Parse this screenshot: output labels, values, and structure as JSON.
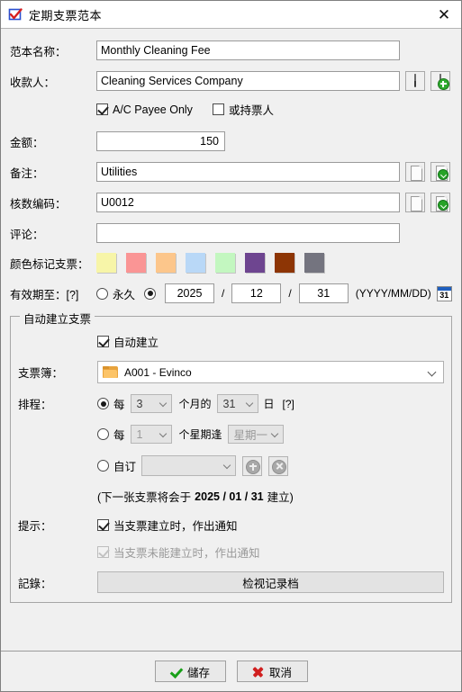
{
  "window": {
    "title": "定期支票范本",
    "title_icon": "cheque-check-icon",
    "close_label": "✕"
  },
  "form": {
    "template_name": {
      "label": "范本名称：",
      "value": "Monthly Cleaning Fee"
    },
    "payee": {
      "label": "收款人：",
      "value": "Cleaning Services Company",
      "buttons": [
        {
          "icon": "person-icon"
        },
        {
          "icon": "person-add-icon"
        }
      ]
    },
    "cheque_options": {
      "ac_payee_only": {
        "label": "A/C Payee Only",
        "checked": true
      },
      "or_bearer": {
        "label": "或持票人",
        "checked": false
      }
    },
    "amount": {
      "label": "金额：",
      "value": "150"
    },
    "remark": {
      "label": "备注：",
      "value": "Utilities",
      "buttons": [
        {
          "icon": "page-icon"
        },
        {
          "icon": "page-save-icon"
        }
      ]
    },
    "audit_code": {
      "label": "核数编码：",
      "value": "U0012",
      "buttons": [
        {
          "icon": "page-icon"
        },
        {
          "icon": "page-save-icon"
        }
      ]
    },
    "comment": {
      "label": "评论：",
      "value": ""
    },
    "color_tag": {
      "label": "颜色标记支票：",
      "colors": [
        "#f7f5a8",
        "#fa9595",
        "#fcc68b",
        "#b9d8f7",
        "#c3f7c0",
        "#6e4590",
        "#8d3505",
        "#74747f"
      ]
    },
    "validity": {
      "label": "有效期至：[?]",
      "forever": {
        "label": "永久",
        "selected": false
      },
      "until": {
        "selected": true
      },
      "year": "2025",
      "month": "12",
      "day": "31",
      "format_hint": "(YYYY/MM/DD)",
      "calendar_icon_day": "31"
    }
  },
  "auto_create": {
    "legend": "自动建立支票",
    "auto_create_checkbox": {
      "label": "自动建立",
      "checked": true
    },
    "chequebook": {
      "label": "支票簿：",
      "value": "A001 - Evinco",
      "icon": "folder-icon"
    },
    "schedule": {
      "label": "排程：",
      "monthly": {
        "selected": true,
        "prefix": "每",
        "interval": "3",
        "middle": "个月的",
        "day": "31",
        "suffix": "日",
        "hint": "[?]"
      },
      "weekly": {
        "selected": false,
        "prefix": "每",
        "interval": "1",
        "middle": "个星期逢",
        "weekday": "星期一"
      },
      "custom": {
        "selected": false,
        "label": "自订",
        "value": "",
        "add_icon": "circle-plus-icon",
        "remove_icon": "circle-cross-icon"
      },
      "next_note_prefix": "(下一张支票将会于",
      "next_note_date": "2025 / 01 / 31",
      "next_note_suffix": "建立)"
    },
    "notify": {
      "label": "提示：",
      "on_created": {
        "label": "当支票建立时，作出通知",
        "checked": true,
        "enabled": true
      },
      "on_failed": {
        "label": "当支票未能建立时，作出通知",
        "checked": true,
        "enabled": false
      }
    },
    "record": {
      "label": "記錄：",
      "button_label": "检视记录档"
    }
  },
  "footer": {
    "save_label": "儲存",
    "cancel_label": "取消"
  }
}
